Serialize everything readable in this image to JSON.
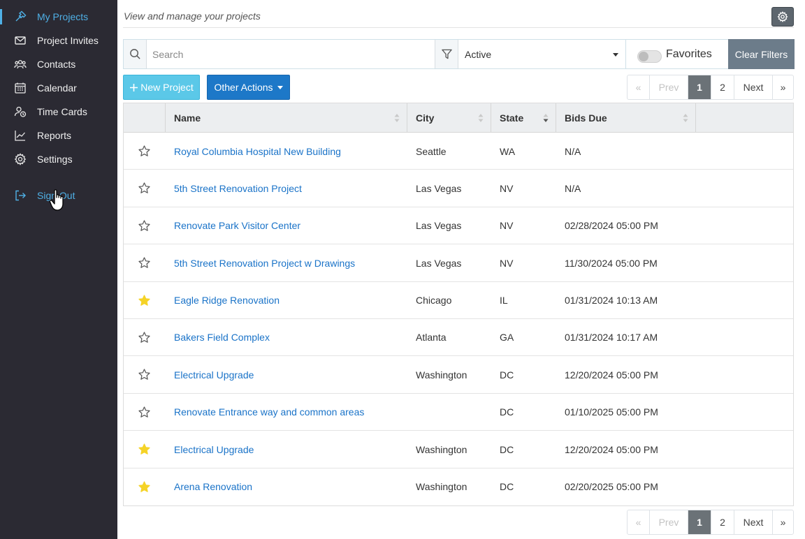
{
  "sidebar": {
    "items": [
      {
        "label": "My Projects",
        "icon": "hammer-icon"
      },
      {
        "label": "Project Invites",
        "icon": "envelope-icon"
      },
      {
        "label": "Contacts",
        "icon": "users-icon"
      },
      {
        "label": "Calendar",
        "icon": "calendar-icon"
      },
      {
        "label": "Time Cards",
        "icon": "user-clock-icon"
      },
      {
        "label": "Reports",
        "icon": "chart-line-icon"
      },
      {
        "label": "Settings",
        "icon": "gear-icon"
      },
      {
        "label": "Sign Out",
        "icon": "sign-out-icon"
      }
    ]
  },
  "header": {
    "subtitle": "View and manage your projects"
  },
  "filters": {
    "search_placeholder": "Search",
    "status_value": "Active",
    "favorites_label": "Favorites",
    "favorites_on": false,
    "clear_label": "Clear Filters"
  },
  "actions": {
    "new_project": "New Project",
    "other_actions": "Other Actions"
  },
  "pagination": {
    "first": "«",
    "prev": "Prev",
    "pages": [
      "1",
      "2"
    ],
    "current": "1",
    "next": "Next",
    "last": "»"
  },
  "table": {
    "columns": [
      "Name",
      "City",
      "State",
      "Bids Due"
    ],
    "rows": [
      {
        "favorite": false,
        "name": "Royal Columbia Hospital New Building",
        "city": "Seattle",
        "state": "WA",
        "bids_due": "N/A"
      },
      {
        "favorite": false,
        "name": "5th Street Renovation Project",
        "city": "Las Vegas",
        "state": "NV",
        "bids_due": "N/A"
      },
      {
        "favorite": false,
        "name": "Renovate Park Visitor Center",
        "city": "Las Vegas",
        "state": "NV",
        "bids_due": "02/28/2024 05:00 PM"
      },
      {
        "favorite": false,
        "name": "5th Street Renovation Project w Drawings",
        "city": "Las Vegas",
        "state": "NV",
        "bids_due": "11/30/2024 05:00 PM"
      },
      {
        "favorite": true,
        "name": "Eagle Ridge Renovation",
        "city": "Chicago",
        "state": "IL",
        "bids_due": "01/31/2024 10:13 AM"
      },
      {
        "favorite": false,
        "name": "Bakers Field Complex",
        "city": "Atlanta",
        "state": "GA",
        "bids_due": "01/31/2024 10:17 AM"
      },
      {
        "favorite": false,
        "name": "Electrical Upgrade",
        "city": "Washington",
        "state": "DC",
        "bids_due": "12/20/2024 05:00 PM"
      },
      {
        "favorite": false,
        "name": "Renovate Entrance way and common areas",
        "city": "",
        "state": "DC",
        "bids_due": "01/10/2025 05:00 PM"
      },
      {
        "favorite": true,
        "name": "Electrical Upgrade",
        "city": "Washington",
        "state": "DC",
        "bids_due": "12/20/2024 05:00 PM"
      },
      {
        "favorite": true,
        "name": "Arena Renovation",
        "city": "Washington",
        "state": "DC",
        "bids_due": "02/20/2025 05:00 PM"
      }
    ]
  },
  "colors": {
    "sidebar_bg": "#2b2a33",
    "accent": "#4fb0e6",
    "link": "#1a73c8",
    "star_filled": "#f5d327"
  }
}
